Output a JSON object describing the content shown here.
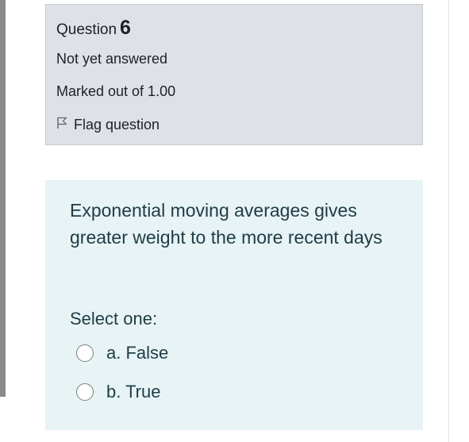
{
  "question_info": {
    "label": "Question",
    "number": "6",
    "state": "Not yet answered",
    "grade": "Marked out of 1.00",
    "flag_label": "Flag question"
  },
  "question": {
    "text": "Exponential moving averages gives greater weight to the more recent days",
    "prompt": "Select one:",
    "options": [
      {
        "label": "a. False",
        "selected": false
      },
      {
        "label": "b. True",
        "selected": false
      }
    ]
  },
  "colors": {
    "info_background": "#dee2e6",
    "content_background": "#e7f3f5",
    "text": "#1f3c45"
  },
  "icons": {
    "flag": "flag-icon"
  }
}
